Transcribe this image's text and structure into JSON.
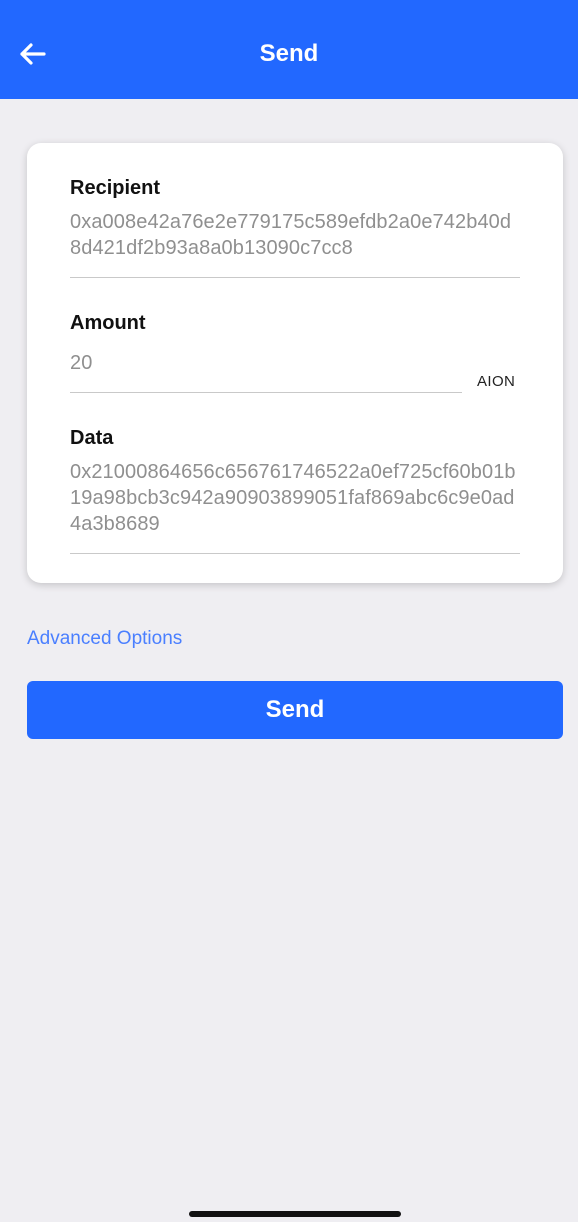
{
  "header": {
    "title": "Send",
    "back_icon": "arrow-left-icon"
  },
  "form": {
    "recipient": {
      "label": "Recipient",
      "value": "0xa008e42a76e2e779175c589efdb2a0e742b40d8d421df2b93a8a0b13090c7cc8"
    },
    "amount": {
      "label": "Amount",
      "value": "20",
      "unit": "AION"
    },
    "data": {
      "label": "Data",
      "value": "0x21000864656c656761746522a0ef725cf60b01b19a98bcb3c942a90903899051faf869abc6c9e0ad4a3b8689"
    }
  },
  "advanced_options_label": "Advanced Options",
  "send_button_label": "Send",
  "colors": {
    "primary": "#2268ff",
    "link": "#4a7fff",
    "background": "#efeef2"
  }
}
